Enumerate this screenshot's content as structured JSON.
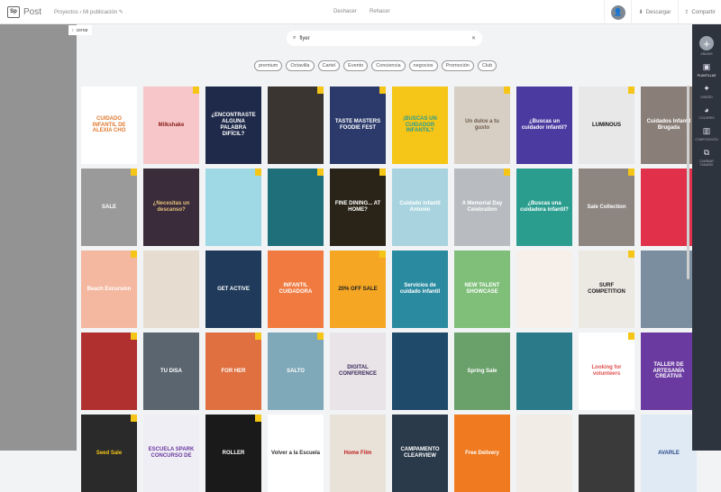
{
  "header": {
    "logo": "Sp",
    "app": "Post",
    "breadcrumb": [
      "Proyectos",
      "Mi publicación"
    ],
    "undo": "Deshacer",
    "redo": "Rehacer",
    "download": "Descargar",
    "share": "Compartir"
  },
  "panel": {
    "close": "cerrar",
    "search_value": "flyer"
  },
  "filters": [
    "premium",
    "Octavilla",
    "Cartel",
    "Evento",
    "Conciencia",
    "negocios",
    "Promoción",
    "Club"
  ],
  "sidebar": [
    {
      "label": "AÑADIR",
      "icon": "plus-icon"
    },
    {
      "label": "PLANTILLAS",
      "icon": "image-icon"
    },
    {
      "label": "DISEÑO",
      "icon": "magic-wand-icon"
    },
    {
      "label": "COLORES",
      "icon": "palette-icon"
    },
    {
      "label": "COMPOSICIÓN",
      "icon": "layout-icon"
    },
    {
      "label": "CAMBIAR TAMAÑO",
      "icon": "resize-icon"
    }
  ],
  "templates": [
    {
      "t": "CUIDADO INFANTIL DE ALEXIA CHO",
      "bg": "#ffffff",
      "fg": "#e07a30",
      "p": false
    },
    {
      "t": "Milkshake",
      "bg": "#f6c6c8",
      "fg": "#8a1a1a",
      "p": true
    },
    {
      "t": "¿ENCONTRASTE ALGUNA PALABRA DIFÍCIL?",
      "bg": "#1f2a4a",
      "fg": "#ffffff",
      "p": false
    },
    {
      "t": "",
      "bg": "#3a3530",
      "fg": "#fff",
      "p": true
    },
    {
      "t": "TASTE MASTERS FOODIE FEST",
      "bg": "#2b3a6b",
      "fg": "#ffffff",
      "p": true
    },
    {
      "t": "¡BUSCAS UN CUIDADOR INFANTIL?",
      "bg": "#f5c518",
      "fg": "#2a9d8f",
      "p": false
    },
    {
      "t": "Un dulce a tu gusto",
      "bg": "#d8cfc4",
      "fg": "#6b5a4a",
      "p": true
    },
    {
      "t": "¿Buscas un cuidador infantil?",
      "bg": "#4b3aa0",
      "fg": "#ffffff",
      "p": false
    },
    {
      "t": "LUMINOUS",
      "bg": "#e8e8e8",
      "fg": "#111",
      "p": true
    },
    {
      "t": "Cuidados Infantil Brugada",
      "bg": "#8a7f78",
      "fg": "#ffffff",
      "p": false
    },
    {
      "t": "SALE",
      "bg": "#9a9a9a",
      "fg": "#ffffff",
      "p": true
    },
    {
      "t": "¿Necesitas un descanso?",
      "bg": "#3a2c3a",
      "fg": "#e5c07b",
      "p": false
    },
    {
      "t": "",
      "bg": "#9fd9e6",
      "fg": "#111",
      "p": true
    },
    {
      "t": "",
      "bg": "#1f6f7a",
      "fg": "#fff",
      "p": true
    },
    {
      "t": "FINE DINING... AT HOME?",
      "bg": "#2a2418",
      "fg": "#ffffff",
      "p": true
    },
    {
      "t": "Cuidado infantil Antonio",
      "bg": "#a9d4df",
      "fg": "#ffffff",
      "p": false
    },
    {
      "t": "A Memorial Day Celebration",
      "bg": "#b8bcc0",
      "fg": "#ffffff",
      "p": true
    },
    {
      "t": "¿Buscas una cuidadora infantil?",
      "bg": "#2a9d8f",
      "fg": "#ffffff",
      "p": false
    },
    {
      "t": "Sale Collection",
      "bg": "#8c8580",
      "fg": "#ffffff",
      "p": true
    },
    {
      "t": "",
      "bg": "#e0304a",
      "fg": "#1a1a3a",
      "p": false
    },
    {
      "t": "Beach Excursion",
      "bg": "#f4b8a0",
      "fg": "#ffffff",
      "p": true
    },
    {
      "t": "",
      "bg": "#e6ddd0",
      "fg": "#555",
      "p": false
    },
    {
      "t": "GET ACTIVE",
      "bg": "#1f3a5a",
      "fg": "#ffffff",
      "p": false
    },
    {
      "t": "INFANTIL CUIDADORA",
      "bg": "#f07a40",
      "fg": "#ffffff",
      "p": false
    },
    {
      "t": "20% OFF SALE",
      "bg": "#f5a623",
      "fg": "#222",
      "p": true
    },
    {
      "t": "Servicios de cuidado infantil",
      "bg": "#2a8aa0",
      "fg": "#ffffff",
      "p": false
    },
    {
      "t": "NEW TALENT SHOWCASE",
      "bg": "#7fbf7a",
      "fg": "#ffffff",
      "p": false
    },
    {
      "t": "",
      "bg": "#f7f0ea",
      "fg": "#c0504d",
      "p": false
    },
    {
      "t": "SURF COMPETITION",
      "bg": "#ece8e2",
      "fg": "#222",
      "p": true
    },
    {
      "t": "",
      "bg": "#7a8ea0",
      "fg": "#fff",
      "p": false
    },
    {
      "t": "",
      "bg": "#b03030",
      "fg": "#fff",
      "p": true
    },
    {
      "t": "TU DISA",
      "bg": "#5a6570",
      "fg": "#ffffff",
      "p": false
    },
    {
      "t": "FOR HER",
      "bg": "#e07040",
      "fg": "#ffffff",
      "p": true
    },
    {
      "t": "SALTO",
      "bg": "#7fa8b8",
      "fg": "#ffffff",
      "p": true
    },
    {
      "t": "DIGITAL CONFERENCE",
      "bg": "#e8e4e8",
      "fg": "#3a2a5a",
      "p": false
    },
    {
      "t": "",
      "bg": "#1f4a6a",
      "fg": "#fff",
      "p": false
    },
    {
      "t": "Spring Sale",
      "bg": "#6aa06a",
      "fg": "#ffffff",
      "p": false
    },
    {
      "t": "",
      "bg": "#2a7a8a",
      "fg": "#fff",
      "p": false
    },
    {
      "t": "Looking for volunteers",
      "bg": "#ffffff",
      "fg": "#e05050",
      "p": true
    },
    {
      "t": "TALLER DE ARTESANÍA CREATIVA",
      "bg": "#6a3aa0",
      "fg": "#ffffff",
      "p": false
    },
    {
      "t": "Seed Sale",
      "bg": "#2a2a2a",
      "fg": "#f5c518",
      "p": true
    },
    {
      "t": "ESCUELA SPARK CONCURSO DE",
      "bg": "#f0eef5",
      "fg": "#6a3aa0",
      "p": false
    },
    {
      "t": "ROLLER",
      "bg": "#1a1a1a",
      "fg": "#ffffff",
      "p": true
    },
    {
      "t": "Volver a la Escuela",
      "bg": "#ffffff",
      "fg": "#333",
      "p": false
    },
    {
      "t": "Home Film",
      "bg": "#e8e2d8",
      "fg": "#c02020",
      "p": false
    },
    {
      "t": "CAMPAMENTO CLEARVIEW",
      "bg": "#2a3a4a",
      "fg": "#ffffff",
      "p": false
    },
    {
      "t": "Free Delivery",
      "bg": "#f07a20",
      "fg": "#ffffff",
      "p": false
    },
    {
      "t": "",
      "bg": "#f2ece6",
      "fg": "#333",
      "p": false
    },
    {
      "t": "",
      "bg": "#3a3a3a",
      "fg": "#fff",
      "p": false
    },
    {
      "t": "AVARLE",
      "bg": "#dfeaf5",
      "fg": "#2a4a8a",
      "p": false
    }
  ]
}
